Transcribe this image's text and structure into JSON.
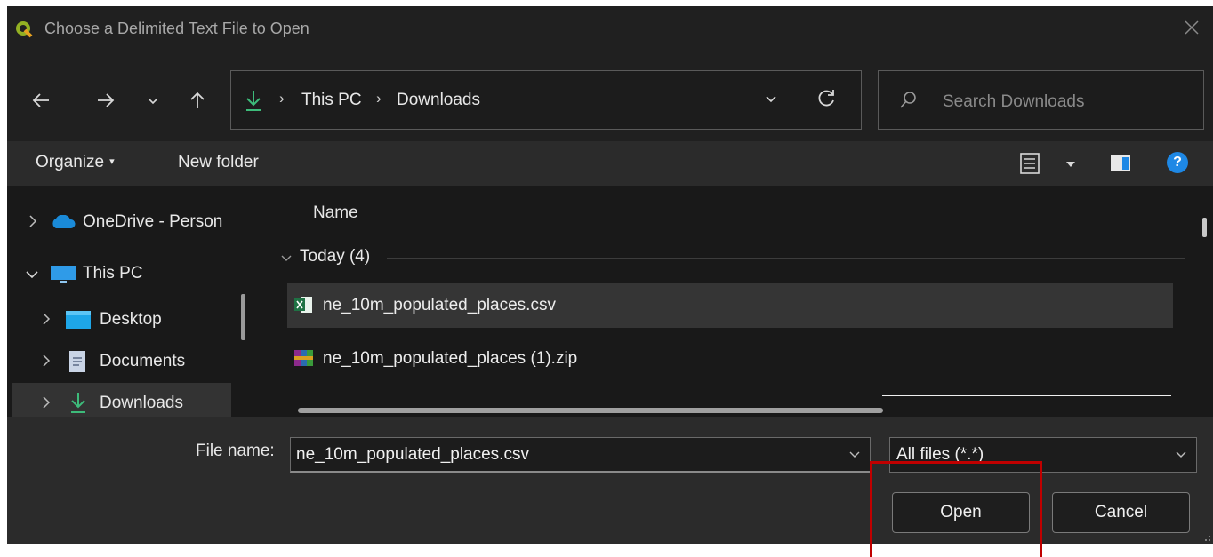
{
  "window": {
    "title": "Choose a Delimited Text File to Open",
    "app_icon": "qgis-logo-icon"
  },
  "nav": {
    "back_icon": "back-arrow-icon",
    "forward_icon": "forward-arrow-icon",
    "recent_icon": "chevron-down-icon",
    "up_icon": "up-arrow-icon"
  },
  "address": {
    "location_icon": "download-icon",
    "separator": "›",
    "crumbs": [
      "This PC",
      "Downloads"
    ]
  },
  "search": {
    "placeholder": "Search Downloads"
  },
  "toolbar": {
    "organize_label": "Organize",
    "organize_arrow": "▾",
    "new_folder_label": "New folder",
    "help_label": "?"
  },
  "sidebar": {
    "items": [
      {
        "label": "OneDrive - Person",
        "icon": "cloud-icon",
        "expanded": false
      },
      {
        "label": "This PC",
        "icon": "monitor-icon",
        "expanded": true
      },
      {
        "label": "Desktop",
        "icon": "desktop-folder-icon",
        "expanded": false
      },
      {
        "label": "Documents",
        "icon": "document-folder-icon",
        "expanded": false
      },
      {
        "label": "Downloads",
        "icon": "download-icon",
        "expanded": false,
        "selected": true
      }
    ]
  },
  "file_list": {
    "column_name": "Name",
    "group_label": "Today (4)",
    "files": [
      {
        "name": "ne_10m_populated_places.csv",
        "icon": "excel-csv-icon",
        "selected": true
      },
      {
        "name": "ne_10m_populated_places (1).zip",
        "icon": "winrar-archive-icon",
        "selected": false
      }
    ]
  },
  "footer": {
    "file_name_label": "File name:",
    "file_name_value": "ne_10m_populated_places.csv",
    "filter_value": "All files  (*.*)",
    "open_label": "Open",
    "cancel_label": "Cancel"
  },
  "colors": {
    "highlight": "#c00000",
    "accent_green": "#3dbb7a",
    "help_blue": "#1e88e5"
  }
}
